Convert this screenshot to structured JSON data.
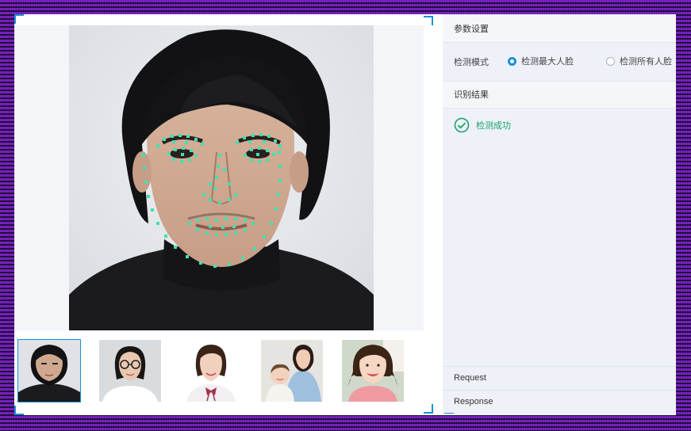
{
  "settings": {
    "header": "参数设置",
    "mode_label": "检测模式",
    "options": [
      {
        "label": "检测最大人脸",
        "selected": true
      },
      {
        "label": "检测所有人脸",
        "selected": false
      }
    ]
  },
  "result": {
    "header": "识别结果",
    "status": "检测成功",
    "status_color": "#1aa36a"
  },
  "footer": {
    "request_label": "Request",
    "response_label": "Response"
  },
  "thumbnails": [
    {
      "name": "long-hair-man",
      "active": true
    },
    {
      "name": "woman-with-glasses",
      "active": false
    },
    {
      "name": "woman-with-bow-tie",
      "active": false
    },
    {
      "name": "mother-and-baby",
      "active": false
    },
    {
      "name": "smiling-girl",
      "active": false
    }
  ],
  "colors": {
    "accent": "#1890d8",
    "landmark": "#3ee2b0",
    "frame": "#7b22c9"
  }
}
